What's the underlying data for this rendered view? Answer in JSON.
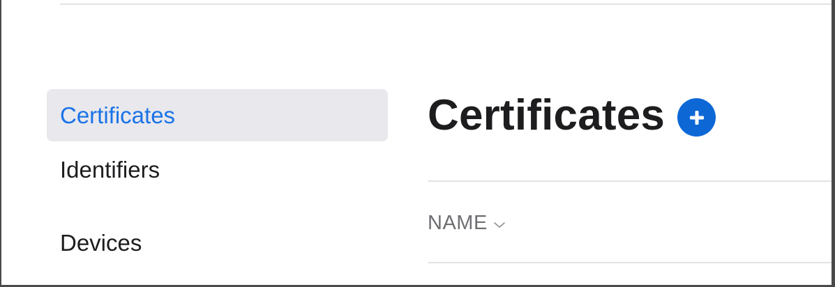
{
  "sidebar": {
    "items": [
      {
        "label": "Certificates",
        "active": true
      },
      {
        "label": "Identifiers",
        "active": false
      },
      {
        "label": "Devices",
        "active": false
      }
    ]
  },
  "main": {
    "title": "Certificates",
    "add_icon": "plus-circle-icon",
    "columns": [
      {
        "label": "NAME",
        "sort_icon": "chevron-down-icon"
      }
    ]
  },
  "colors": {
    "accent": "#0d68d6",
    "active_text": "#1a73e8",
    "active_bg": "#e8e8ed",
    "text_primary": "#1d1d1f",
    "text_secondary": "#6e6e73",
    "divider": "#e3e3e6"
  }
}
